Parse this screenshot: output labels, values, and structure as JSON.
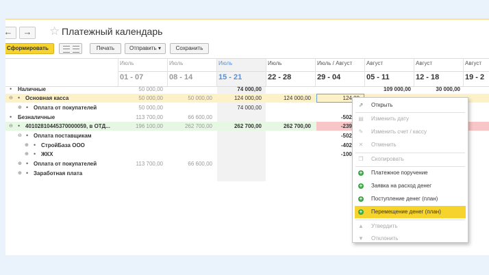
{
  "window": {
    "title": "Платежный календарь",
    "nav_back": "←",
    "nav_forward": "→",
    "star": "☆"
  },
  "toolbar": {
    "generate_label": "Сформировать",
    "print_label": "Печать",
    "send_label": "Отправить ▾",
    "save_label": "Сохранить"
  },
  "columns": [
    {
      "month": "Июль",
      "range": "01 - 07"
    },
    {
      "month": "Июль",
      "range": "08 - 14"
    },
    {
      "month": "Июль",
      "range": "15 - 21"
    },
    {
      "month": "Июль",
      "range": "22 - 28"
    },
    {
      "month": "Июль / Август",
      "range": "29 - 04"
    },
    {
      "month": "Август",
      "range": "05 - 11"
    },
    {
      "month": "Август",
      "range": "12 - 18"
    },
    {
      "month": "Август",
      "range": "19 - 2"
    }
  ],
  "rows": [
    {
      "label": "Наличные",
      "values": [
        "50 000,00",
        "",
        "74 000,00",
        "",
        "",
        "109 000,00",
        "30 000,00",
        ""
      ]
    },
    {
      "label": "Основная касса",
      "values": [
        "50 000,00",
        "50 000,00",
        "124 000,00",
        "124 000,00",
        "124 00",
        "",
        "",
        ""
      ]
    },
    {
      "label": "Оплата от покупателей",
      "values": [
        "50 000,00",
        "",
        "74 000,00",
        "",
        "",
        "",
        "",
        ""
      ]
    },
    {
      "label": "Безналичные",
      "values": [
        "113 700,00",
        "66 600,00",
        "",
        "",
        "-502 00",
        "",
        "",
        ""
      ]
    },
    {
      "label": "40102810445370000059, в ОТД...",
      "values": [
        "196 100,00",
        "262 700,00",
        "262 700,00",
        "262 700,00",
        "-239 30",
        "",
        "",
        ""
      ]
    },
    {
      "label": "Оплата поставщикам",
      "values": [
        "",
        "",
        "",
        "",
        "-502 00",
        "",
        "",
        ""
      ]
    },
    {
      "label": "СтройБаза ООО",
      "values": [
        "",
        "",
        "",
        "",
        "-402 00",
        "",
        "",
        ""
      ]
    },
    {
      "label": "ЖКХ",
      "values": [
        "",
        "",
        "",
        "",
        "-100 00",
        "",
        "",
        ""
      ]
    },
    {
      "label": "Оплата от покупателей",
      "values": [
        "113 700,00",
        "66 600,00",
        "",
        "",
        "",
        "",
        "",
        ""
      ]
    },
    {
      "label": "Заработная плата",
      "values": [
        "",
        "",
        "",
        "",
        "",
        "",
        "",
        ""
      ]
    }
  ],
  "context_menu": [
    {
      "label": "Открыть",
      "icon": "open-icon",
      "enabled": true
    },
    {
      "label": "Изменить дату",
      "icon": "calendar-icon",
      "enabled": false
    },
    {
      "label": "Изменить счет / кассу",
      "icon": "pencil-icon",
      "enabled": false
    },
    {
      "label": "Отменить",
      "icon": "cancel-icon",
      "enabled": false
    },
    {
      "label": "Скопировать",
      "icon": "copy-icon",
      "enabled": false
    },
    {
      "label": "Платежное поручение",
      "icon": "plus-icon",
      "enabled": true
    },
    {
      "label": "Заявка на расход денег",
      "icon": "plus-icon",
      "enabled": true
    },
    {
      "label": "Поступление денег (план)",
      "icon": "plus-icon",
      "enabled": true
    },
    {
      "label": "Перемещение денег (план)",
      "icon": "plus-icon",
      "enabled": true,
      "highlighted": true
    },
    {
      "label": "Утвердить",
      "icon": "thumbs-up-icon",
      "enabled": false
    },
    {
      "label": "Отклонить",
      "icon": "thumbs-down-icon",
      "enabled": false
    }
  ],
  "colors": {
    "accent": "#f6d32d",
    "negative": "#f8c6c6",
    "highlight_row": "#fdf1c8",
    "green_row": "#e6f8e3"
  }
}
